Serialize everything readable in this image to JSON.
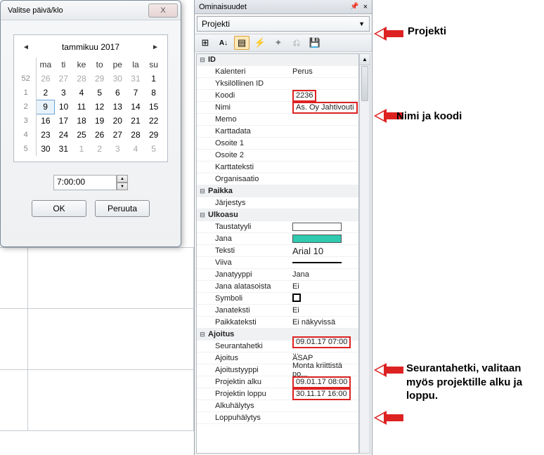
{
  "dialog": {
    "title": "Valitse päivä/klo",
    "close": "X",
    "month": "tammikuu 2017",
    "prev": "◄",
    "next": "►",
    "dow": [
      "ma",
      "ti",
      "ke",
      "to",
      "pe",
      "la",
      "su"
    ],
    "weeks": [
      {
        "wk": "52",
        "days": [
          {
            "d": "26",
            "o": 1
          },
          {
            "d": "27",
            "o": 1
          },
          {
            "d": "28",
            "o": 1
          },
          {
            "d": "29",
            "o": 1
          },
          {
            "d": "30",
            "o": 1
          },
          {
            "d": "31",
            "o": 1
          },
          {
            "d": "1"
          }
        ]
      },
      {
        "wk": "1",
        "days": [
          {
            "d": "2"
          },
          {
            "d": "3"
          },
          {
            "d": "4"
          },
          {
            "d": "5"
          },
          {
            "d": "6"
          },
          {
            "d": "7"
          },
          {
            "d": "8"
          }
        ]
      },
      {
        "wk": "2",
        "days": [
          {
            "d": "9",
            "sel": 1
          },
          {
            "d": "10"
          },
          {
            "d": "11"
          },
          {
            "d": "12"
          },
          {
            "d": "13"
          },
          {
            "d": "14"
          },
          {
            "d": "15"
          }
        ]
      },
      {
        "wk": "3",
        "days": [
          {
            "d": "16"
          },
          {
            "d": "17"
          },
          {
            "d": "18"
          },
          {
            "d": "19"
          },
          {
            "d": "20"
          },
          {
            "d": "21"
          },
          {
            "d": "22"
          }
        ]
      },
      {
        "wk": "4",
        "days": [
          {
            "d": "23"
          },
          {
            "d": "24"
          },
          {
            "d": "25"
          },
          {
            "d": "26"
          },
          {
            "d": "27"
          },
          {
            "d": "28"
          },
          {
            "d": "29"
          }
        ]
      },
      {
        "wk": "5",
        "days": [
          {
            "d": "30"
          },
          {
            "d": "31"
          },
          {
            "d": "1",
            "o": 1
          },
          {
            "d": "2",
            "o": 1
          },
          {
            "d": "3",
            "o": 1
          },
          {
            "d": "4",
            "o": 1
          },
          {
            "d": "5",
            "o": 1
          }
        ]
      }
    ],
    "time": "7:00:00",
    "ok": "OK",
    "cancel": "Peruuta"
  },
  "props": {
    "title": "Ominaisuudet",
    "project": "Projekti",
    "groups": {
      "id": "ID",
      "paikka": "Paikka",
      "ulkoasu": "Ulkoasu",
      "ajoitus": "Ajoitus"
    },
    "rows": {
      "kalenteri": {
        "l": "Kalenteri",
        "v": "Perus"
      },
      "yksid": {
        "l": "Yksilöllinen ID",
        "v": ""
      },
      "koodi": {
        "l": "Koodi",
        "v": "2236"
      },
      "nimi": {
        "l": "Nimi",
        "v": "As. Oy Jahtivouti"
      },
      "memo": {
        "l": "Memo",
        "v": ""
      },
      "karttadata": {
        "l": "Karttadata",
        "v": ""
      },
      "osoite1": {
        "l": "Osoite 1",
        "v": ""
      },
      "osoite2": {
        "l": "Osoite 2",
        "v": ""
      },
      "karttateksti": {
        "l": "Karttateksti",
        "v": ""
      },
      "organisaatio": {
        "l": "Organisaatio",
        "v": ""
      },
      "jarjestys": {
        "l": "Järjestys",
        "v": ""
      },
      "taustatyyli": {
        "l": "Taustatyyli",
        "v": ""
      },
      "jana": {
        "l": "Jana",
        "v": ""
      },
      "teksti": {
        "l": "Teksti",
        "v": "Arial 10"
      },
      "viiva": {
        "l": "Viiva",
        "v": ""
      },
      "janatyyppi": {
        "l": "Janatyyppi",
        "v": "Jana"
      },
      "janaalatasoista": {
        "l": "Jana alatasoista",
        "v": "Ei"
      },
      "symboli": {
        "l": "Symboli",
        "v": ""
      },
      "janateksti": {
        "l": "Janateksti",
        "v": "Ei"
      },
      "paikkateksti": {
        "l": "Paikkateksti",
        "v": "Ei näkyvissä"
      },
      "seurantahetki": {
        "l": "Seurantahetki",
        "v": "09.01.17 07:00"
      },
      "ajoitus": {
        "l": "Ajoitus",
        "v": "ASAP"
      },
      "ajoitustyyppi": {
        "l": "Ajoitustyyppi",
        "v": "Monta kriittistä po..."
      },
      "projektinalku": {
        "l": "Projektin alku",
        "v": "09.01.17 08:00"
      },
      "projektinloppu": {
        "l": "Projektin loppu",
        "v": "30.11.17 16:00"
      },
      "alkuhalytys": {
        "l": "Alkuhälytys",
        "v": ""
      },
      "loppuhalytys": {
        "l": "Loppuhälytys",
        "v": ""
      }
    }
  },
  "ann": {
    "projekti": "Projekti",
    "nimikoodi": "Nimi ja koodi",
    "seuranta": "Seurantahetki, valitaan myös projektille alku ja loppu."
  }
}
